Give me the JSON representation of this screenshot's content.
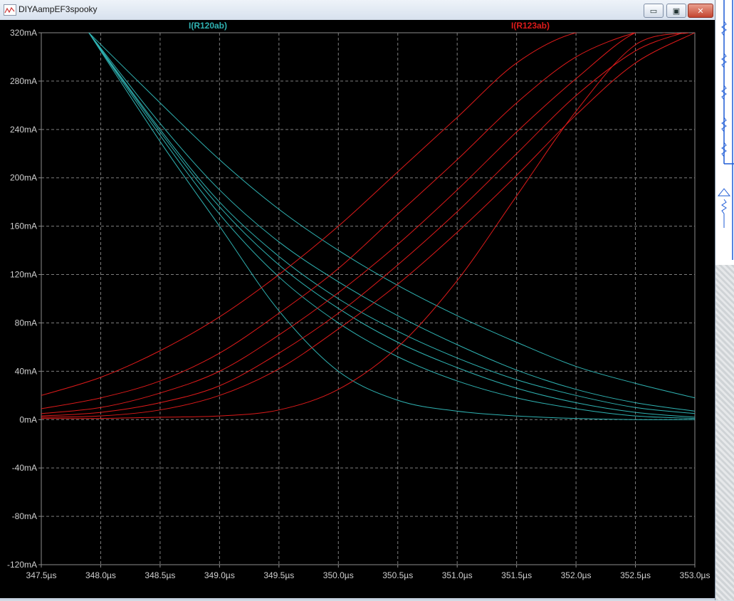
{
  "window": {
    "title": "DIYAampEF3spooky",
    "controls": {
      "minimize": "▭",
      "maximize": "▣",
      "close": "✕"
    }
  },
  "colors": {
    "trace_a": "#2fb2b2",
    "trace_b": "#dd1a1a",
    "axis": "#8c8c8c",
    "label": "#cfcfcf",
    "grid": "#7d7d7d"
  },
  "chart_data": {
    "type": "line",
    "title": "",
    "xlabel": "",
    "ylabel": "",
    "xlim": [
      347.5,
      353.0
    ],
    "ylim": [
      -120,
      320
    ],
    "x_ticks": [
      347.5,
      348.0,
      348.5,
      349.0,
      349.5,
      350.0,
      350.5,
      351.0,
      351.5,
      352.0,
      352.5,
      353.0
    ],
    "x_tick_labels": [
      "347.5µs",
      "348.0µs",
      "348.5µs",
      "349.0µs",
      "349.5µs",
      "350.0µs",
      "350.5µs",
      "351.0µs",
      "351.5µs",
      "352.0µs",
      "352.5µs",
      "353.0µs"
    ],
    "y_ticks": [
      320,
      280,
      240,
      200,
      160,
      120,
      80,
      40,
      0,
      -40,
      -80,
      -120
    ],
    "y_tick_labels": [
      "320mA",
      "280mA",
      "240mA",
      "200mA",
      "160mA",
      "120mA",
      "80mA",
      "40mA",
      "0mA",
      "-40mA",
      "-80mA",
      "-120mA"
    ],
    "grid": true,
    "legend": [
      {
        "label": "I(R120ab)",
        "color": "#2fb2b2"
      },
      {
        "label": "I(R123ab)",
        "color": "#dd1a1a"
      }
    ],
    "series": [
      {
        "name": "I(R120ab)",
        "color": "#2fb2b2",
        "x": [
          347.9,
          348.5,
          349.0,
          349.5,
          350.0,
          350.5,
          351.0,
          351.5,
          352.0,
          352.5,
          353.0
        ],
        "y": [
          320,
          262,
          215,
          174,
          140,
          111,
          86,
          64,
          44,
          30,
          18
        ]
      },
      {
        "name": "I(R120ab)",
        "color": "#2fb2b2",
        "x": [
          347.9,
          348.5,
          349.0,
          349.5,
          350.0,
          350.5,
          351.0,
          351.5,
          352.0,
          352.5,
          353.0
        ],
        "y": [
          320,
          245,
          190,
          147,
          114,
          86,
          62,
          41,
          25,
          14,
          7
        ]
      },
      {
        "name": "I(R120ab)",
        "color": "#2fb2b2",
        "x": [
          347.9,
          348.5,
          349.0,
          349.5,
          350.0,
          350.5,
          351.0,
          351.5,
          352.0,
          352.5,
          353.0
        ],
        "y": [
          320,
          240,
          180,
          135,
          100,
          73,
          51,
          33,
          20,
          10,
          5
        ]
      },
      {
        "name": "I(R120ab)",
        "color": "#2fb2b2",
        "x": [
          347.9,
          348.5,
          349.0,
          349.5,
          350.0,
          350.5,
          351.0,
          351.5,
          352.0,
          352.5,
          353.0
        ],
        "y": [
          320,
          238,
          176,
          128,
          92,
          64,
          43,
          26,
          14,
          6,
          2
        ]
      },
      {
        "name": "I(R120ab)",
        "color": "#2fb2b2",
        "x": [
          347.9,
          348.5,
          349.0,
          349.5,
          350.0,
          350.5,
          351.0,
          351.5,
          352.0,
          352.5,
          353.0
        ],
        "y": [
          320,
          235,
          170,
          118,
          80,
          52,
          32,
          18,
          9,
          3,
          1
        ]
      },
      {
        "name": "I(R120ab)",
        "color": "#2fb2b2",
        "x": [
          347.9,
          348.5,
          349.0,
          349.5,
          350.0,
          350.5,
          351.0,
          351.5,
          352.0,
          352.5,
          353.0
        ],
        "y": [
          320,
          230,
          160,
          90,
          40,
          16,
          7,
          3,
          1,
          0,
          0
        ]
      },
      {
        "name": "I(R123ab)",
        "color": "#dd1a1a",
        "x": [
          347.5,
          348.0,
          348.5,
          349.0,
          349.5,
          350.0,
          350.5,
          351.0,
          351.5,
          352.0,
          352.5
        ],
        "y": [
          20,
          35,
          57,
          85,
          120,
          160,
          205,
          250,
          295,
          320,
          320
        ]
      },
      {
        "name": "I(R123ab)",
        "color": "#dd1a1a",
        "x": [
          347.5,
          348.0,
          348.5,
          349.0,
          349.5,
          350.0,
          350.5,
          351.0,
          351.5,
          352.0,
          352.5,
          352.75
        ],
        "y": [
          9,
          18,
          32,
          55,
          88,
          125,
          170,
          215,
          262,
          300,
          320,
          320
        ]
      },
      {
        "name": "I(R123ab)",
        "color": "#dd1a1a",
        "x": [
          347.5,
          348.0,
          348.5,
          349.0,
          349.5,
          350.0,
          350.5,
          351.0,
          351.5,
          352.0,
          352.5,
          352.85
        ],
        "y": [
          5,
          10,
          22,
          40,
          70,
          105,
          145,
          190,
          238,
          282,
          320,
          320
        ]
      },
      {
        "name": "I(R123ab)",
        "color": "#dd1a1a",
        "x": [
          347.5,
          348.0,
          348.5,
          349.0,
          349.5,
          350.0,
          350.5,
          351.0,
          351.5,
          352.0,
          352.5,
          352.9
        ],
        "y": [
          3,
          6,
          14,
          28,
          55,
          88,
          128,
          172,
          220,
          268,
          305,
          320
        ]
      },
      {
        "name": "I(R123ab)",
        "color": "#dd1a1a",
        "x": [
          347.5,
          348.0,
          348.5,
          349.0,
          349.5,
          350.0,
          350.5,
          351.0,
          351.5,
          352.0,
          352.5,
          353.0
        ],
        "y": [
          2,
          3,
          8,
          20,
          42,
          75,
          112,
          155,
          202,
          252,
          295,
          320
        ]
      },
      {
        "name": "I(R123ab)",
        "color": "#dd1a1a",
        "x": [
          347.5,
          348.0,
          348.5,
          349.0,
          349.5,
          350.0,
          350.5,
          351.0,
          351.5,
          352.0,
          352.5,
          352.95
        ],
        "y": [
          1,
          1,
          2,
          3,
          8,
          25,
          60,
          115,
          185,
          255,
          310,
          320
        ]
      }
    ]
  }
}
